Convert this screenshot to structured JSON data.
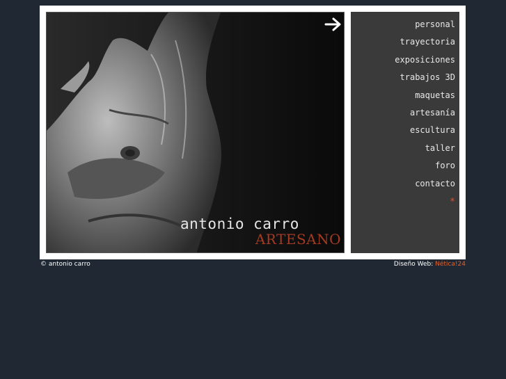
{
  "hero": {
    "name": "antonio carro",
    "subtitle": "ARTESANO",
    "arrow_icon": "arrow-right-icon"
  },
  "menu": {
    "items": [
      {
        "label": "personal"
      },
      {
        "label": "trayectoria"
      },
      {
        "label": "exposiciones"
      },
      {
        "label": "trabajos 3D"
      },
      {
        "label": "maquetas"
      },
      {
        "label": "artesanía"
      },
      {
        "label": "escultura"
      },
      {
        "label": "taller"
      },
      {
        "label": "foro"
      },
      {
        "label": "contacto"
      }
    ],
    "star": "*"
  },
  "footer": {
    "copyright": "© antonio carro",
    "design_label": "Diseño Web:",
    "design_link": "Nética!24"
  },
  "colors": {
    "background": "#1f2833",
    "menu_bg": "#3a3a3a",
    "accent": "#e0622f",
    "subtitle": "#a43a22"
  }
}
